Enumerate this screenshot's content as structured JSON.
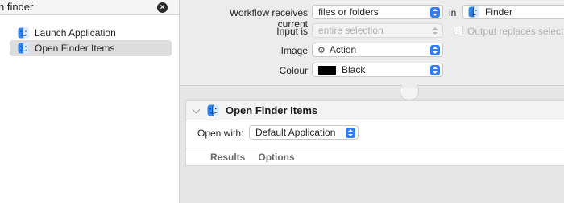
{
  "library": {
    "search": {
      "value": "n finder"
    },
    "results": [
      {
        "label": "Launch Application",
        "selected": false
      },
      {
        "label": "Open Finder Items",
        "selected": true
      }
    ]
  },
  "workflow": {
    "receives_label": "Workflow receives current",
    "receives_value": "files or folders",
    "in_label": "in",
    "app_value": "Finder",
    "input_label": "Input is",
    "input_value": "entire selection",
    "output_replaces_label": "Output replaces selecte",
    "image_label": "Image",
    "image_value": "Action",
    "image_glyph": "⚙",
    "colour_label": "Colour",
    "colour_value": "Black",
    "colour_hex": "#000000"
  },
  "action": {
    "title": "Open Finder Items",
    "open_with_label": "Open with:",
    "open_with_value": "Default Application",
    "tabs": [
      "Results",
      "Options"
    ]
  },
  "icons": {
    "finder": "finder-icon",
    "clear": "clear-search-icon",
    "disclosure": "chevron-down-icon"
  }
}
